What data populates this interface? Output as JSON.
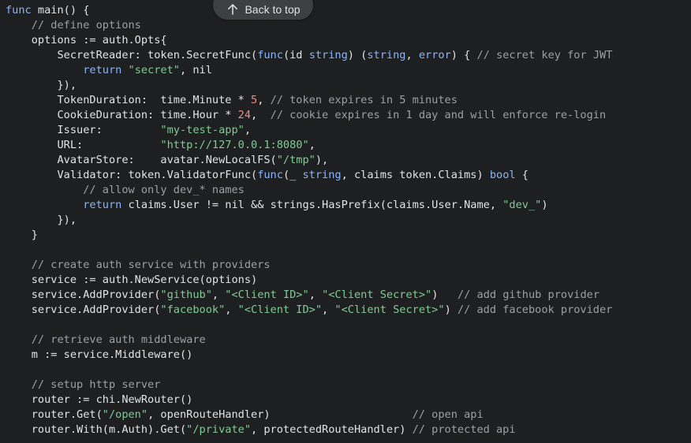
{
  "back_to_top": {
    "label": "Back to top",
    "icon": "arrow-up-icon"
  },
  "colors": {
    "background": "#1e1f20",
    "keyword": "#8ab4f8",
    "string": "#81c995",
    "number": "#f28b82",
    "comment": "#9aa0a6",
    "text": "#e3e3e3",
    "button_bg": "#3c4043"
  },
  "code_lines": [
    [
      {
        "t": "kw",
        "v": "func"
      },
      {
        "t": "pl",
        "v": " main() {"
      }
    ],
    [
      {
        "t": "cm",
        "v": "    // define options"
      }
    ],
    [
      {
        "t": "pl",
        "v": "    options := auth.Opts{"
      }
    ],
    [
      {
        "t": "pl",
        "v": "        SecretReader: token.SecretFunc("
      },
      {
        "t": "kw",
        "v": "func"
      },
      {
        "t": "pl",
        "v": "(id "
      },
      {
        "t": "kw",
        "v": "string"
      },
      {
        "t": "pl",
        "v": ") ("
      },
      {
        "t": "kw",
        "v": "string"
      },
      {
        "t": "pl",
        "v": ", "
      },
      {
        "t": "kw",
        "v": "error"
      },
      {
        "t": "pl",
        "v": ") { "
      },
      {
        "t": "cm",
        "v": "// secret key for JWT"
      }
    ],
    [
      {
        "t": "pl",
        "v": "            "
      },
      {
        "t": "kw",
        "v": "return"
      },
      {
        "t": "pl",
        "v": " "
      },
      {
        "t": "str",
        "v": "\"secret\""
      },
      {
        "t": "pl",
        "v": ", nil"
      }
    ],
    [
      {
        "t": "pl",
        "v": "        }),"
      }
    ],
    [
      {
        "t": "pl",
        "v": "        TokenDuration:  time.Minute * "
      },
      {
        "t": "num",
        "v": "5"
      },
      {
        "t": "pl",
        "v": ", "
      },
      {
        "t": "cm",
        "v": "// token expires in 5 minutes"
      }
    ],
    [
      {
        "t": "pl",
        "v": "        CookieDuration: time.Hour * "
      },
      {
        "t": "num",
        "v": "24"
      },
      {
        "t": "pl",
        "v": ",  "
      },
      {
        "t": "cm",
        "v": "// cookie expires in 1 day and will enforce re-login"
      }
    ],
    [
      {
        "t": "pl",
        "v": "        Issuer:         "
      },
      {
        "t": "str",
        "v": "\"my-test-app\""
      },
      {
        "t": "pl",
        "v": ","
      }
    ],
    [
      {
        "t": "pl",
        "v": "        URL:            "
      },
      {
        "t": "str",
        "v": "\"http://127.0.0.1:8080\""
      },
      {
        "t": "pl",
        "v": ","
      }
    ],
    [
      {
        "t": "pl",
        "v": "        AvatarStore:    avatar.NewLocalFS("
      },
      {
        "t": "str",
        "v": "\"/tmp\""
      },
      {
        "t": "pl",
        "v": "),"
      }
    ],
    [
      {
        "t": "pl",
        "v": "        Validator: token.ValidatorFunc("
      },
      {
        "t": "kw",
        "v": "func"
      },
      {
        "t": "pl",
        "v": "(_ "
      },
      {
        "t": "kw",
        "v": "string"
      },
      {
        "t": "pl",
        "v": ", claims token.Claims) "
      },
      {
        "t": "kw",
        "v": "bool"
      },
      {
        "t": "pl",
        "v": " {"
      }
    ],
    [
      {
        "t": "cm",
        "v": "            // allow only dev_* names"
      }
    ],
    [
      {
        "t": "pl",
        "v": "            "
      },
      {
        "t": "kw",
        "v": "return"
      },
      {
        "t": "pl",
        "v": " claims.User != nil && strings.HasPrefix(claims.User.Name, "
      },
      {
        "t": "str",
        "v": "\"dev_\""
      },
      {
        "t": "pl",
        "v": ")"
      }
    ],
    [
      {
        "t": "pl",
        "v": "        }),"
      }
    ],
    [
      {
        "t": "pl",
        "v": "    }"
      }
    ],
    [
      {
        "t": "pl",
        "v": ""
      }
    ],
    [
      {
        "t": "cm",
        "v": "    // create auth service with providers"
      }
    ],
    [
      {
        "t": "pl",
        "v": "    service := auth.NewService(options)"
      }
    ],
    [
      {
        "t": "pl",
        "v": "    service.AddProvider("
      },
      {
        "t": "str",
        "v": "\"github\""
      },
      {
        "t": "pl",
        "v": ", "
      },
      {
        "t": "str",
        "v": "\"<Client ID>\""
      },
      {
        "t": "pl",
        "v": ", "
      },
      {
        "t": "str",
        "v": "\"<Client Secret>\""
      },
      {
        "t": "pl",
        "v": ")   "
      },
      {
        "t": "cm",
        "v": "// add github provider"
      }
    ],
    [
      {
        "t": "pl",
        "v": "    service.AddProvider("
      },
      {
        "t": "str",
        "v": "\"facebook\""
      },
      {
        "t": "pl",
        "v": ", "
      },
      {
        "t": "str",
        "v": "\"<Client ID>\""
      },
      {
        "t": "pl",
        "v": ", "
      },
      {
        "t": "str",
        "v": "\"<Client Secret>\""
      },
      {
        "t": "pl",
        "v": ") "
      },
      {
        "t": "cm",
        "v": "// add facebook provider"
      }
    ],
    [
      {
        "t": "pl",
        "v": ""
      }
    ],
    [
      {
        "t": "cm",
        "v": "    // retrieve auth middleware"
      }
    ],
    [
      {
        "t": "pl",
        "v": "    m := service.Middleware()"
      }
    ],
    [
      {
        "t": "pl",
        "v": ""
      }
    ],
    [
      {
        "t": "cm",
        "v": "    // setup http server"
      }
    ],
    [
      {
        "t": "pl",
        "v": "    router := chi.NewRouter()"
      }
    ],
    [
      {
        "t": "pl",
        "v": "    router.Get("
      },
      {
        "t": "str",
        "v": "\"/open\""
      },
      {
        "t": "pl",
        "v": ", openRouteHandler)                      "
      },
      {
        "t": "cm",
        "v": "// open api"
      }
    ],
    [
      {
        "t": "pl",
        "v": "    router.With(m.Auth).Get("
      },
      {
        "t": "str",
        "v": "\"/private\""
      },
      {
        "t": "pl",
        "v": ", protectedRouteHandler) "
      },
      {
        "t": "cm",
        "v": "// protected api"
      }
    ]
  ]
}
